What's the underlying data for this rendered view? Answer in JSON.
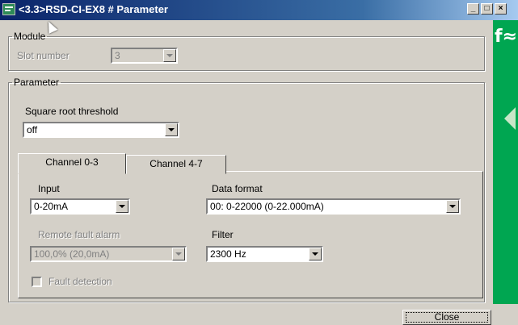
{
  "window": {
    "title": "<3.3>RSD-CI-EX8 # Parameter",
    "buttons": {
      "minimize": "_",
      "maximize": "□",
      "close": "×"
    }
  },
  "logo": {
    "text": "f≈"
  },
  "module": {
    "legend": "Module",
    "slot_label": "Slot number",
    "slot_value": "3"
  },
  "parameter": {
    "legend": "Parameter",
    "sqrt_label": "Square root threshold",
    "sqrt_value": "off",
    "tabs": [
      {
        "label": "Channel 0-3",
        "active": true
      },
      {
        "label": "Channel 4-7",
        "active": false
      }
    ],
    "input_label": "Input",
    "input_value": "0-20mA",
    "data_format_label": "Data format",
    "data_format_value": "00: 0-22000 (0-22.000mA)",
    "remote_fault_label": "Remote fault alarm",
    "remote_fault_value": "100,0% (20,0mA)",
    "filter_label": "Filter",
    "filter_value": "2300 Hz",
    "fault_detection_label": "Fault detection",
    "fault_detection_checked": false
  },
  "footer": {
    "close_label": "Close"
  }
}
